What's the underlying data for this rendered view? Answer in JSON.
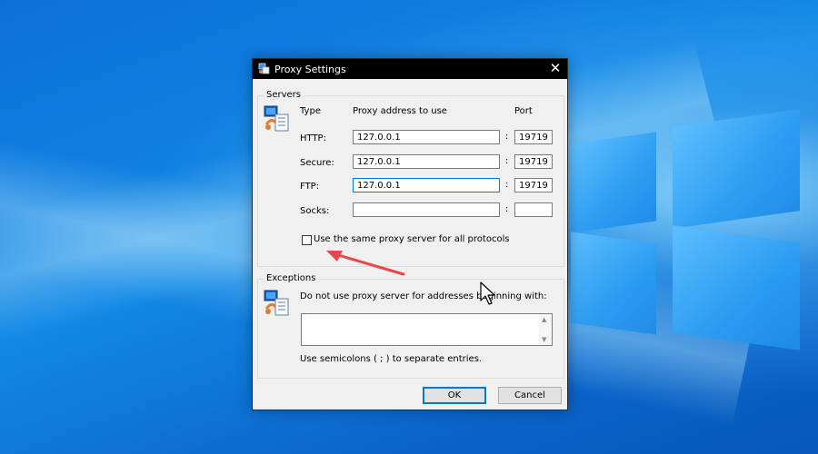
{
  "dialog": {
    "title": "Proxy Settings",
    "close_glyph": "✕",
    "icon": "network-settings-icon"
  },
  "servers": {
    "group_label": "Servers",
    "col_type": "Type",
    "col_address": "Proxy address to use",
    "col_port": "Port",
    "rows": [
      {
        "label": "HTTP:",
        "address": "127.0.0.1",
        "port": "19719"
      },
      {
        "label": "Secure:",
        "address": "127.0.0.1",
        "port": "19719"
      },
      {
        "label": "FTP:",
        "address": "127.0.0.1",
        "port": "19719"
      },
      {
        "label": "Socks:",
        "address": "",
        "port": ""
      }
    ],
    "colon": ":",
    "same_proxy_label": "Use the same proxy server for all protocols",
    "same_proxy_checked": false
  },
  "exceptions": {
    "group_label": "Exceptions",
    "instruction": "Do not use proxy server for addresses beginning with:",
    "value": "",
    "hint": "Use semicolons ( ; ) to separate entries."
  },
  "buttons": {
    "ok": "OK",
    "cancel": "Cancel"
  },
  "colors": {
    "annotation_arrow": "#e84848",
    "focus_border": "#0078d7",
    "desktop_blue": "#0a63c9"
  }
}
